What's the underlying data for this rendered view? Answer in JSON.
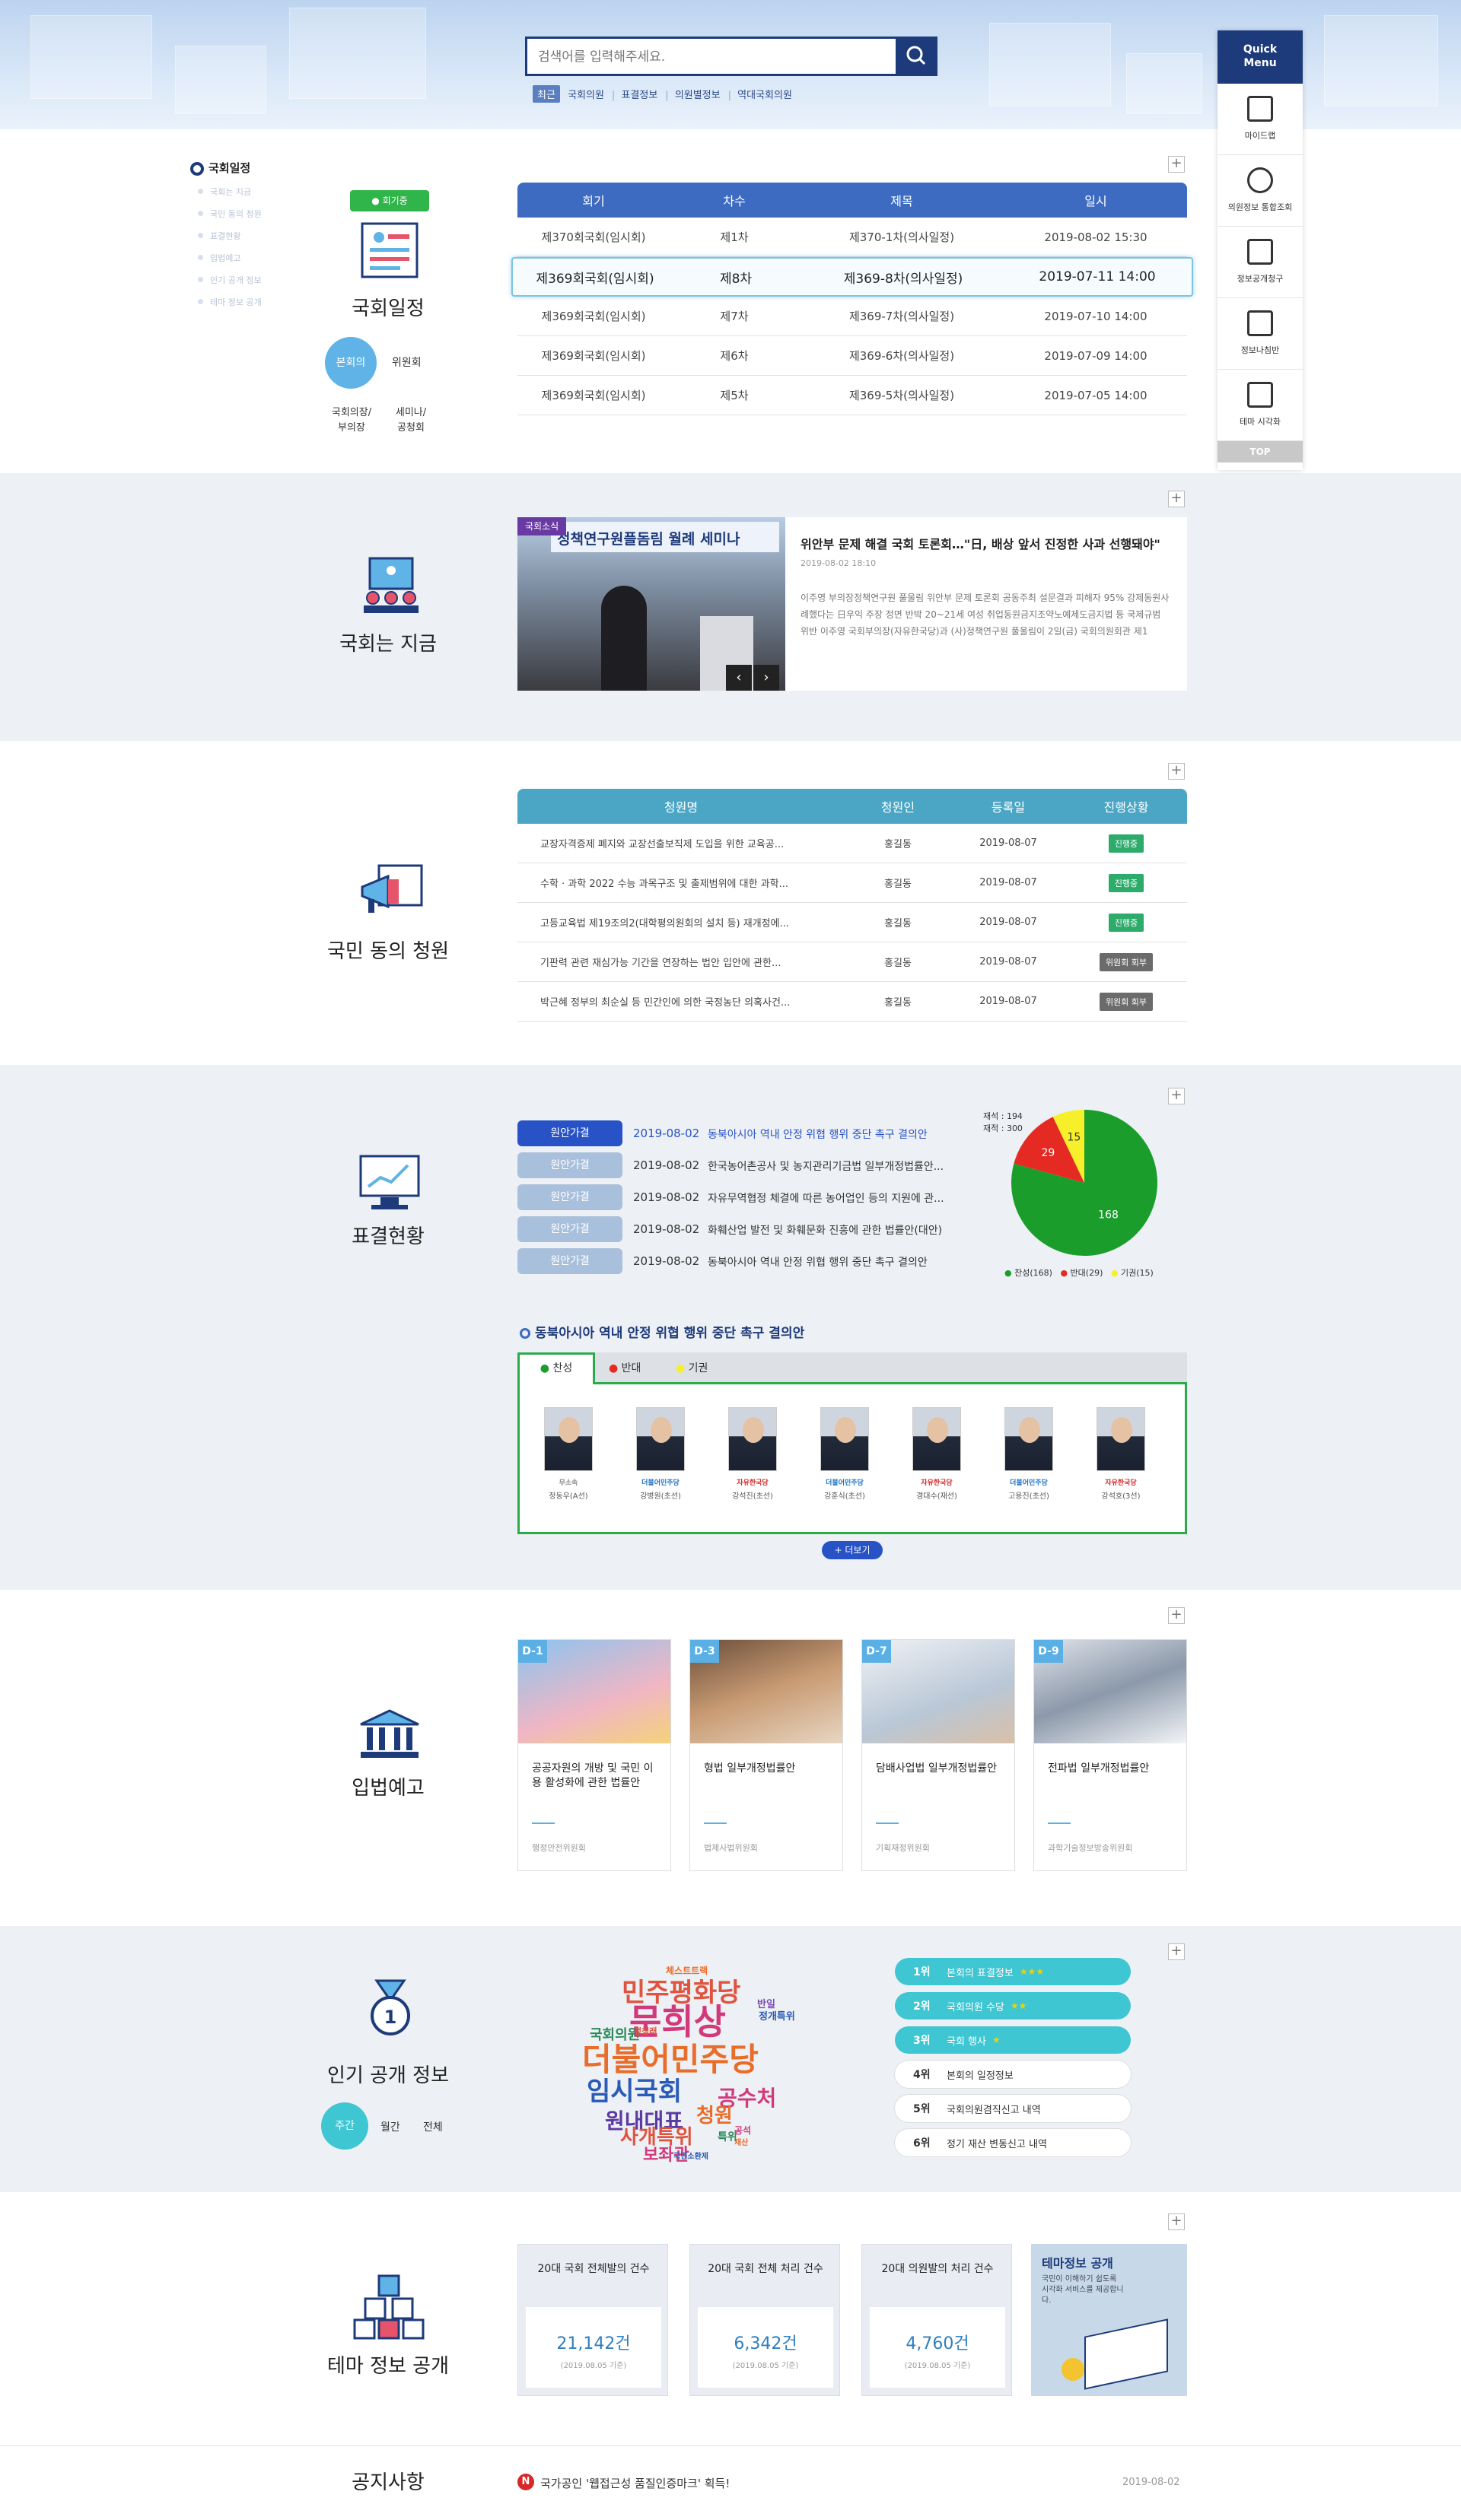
{
  "search": {
    "placeholder": "검색어를 입력해주세요.",
    "recent_label": "최근",
    "tags": [
      "국회의원",
      "표결정보",
      "의원별정보",
      "역대국회의원"
    ]
  },
  "quick_menu": {
    "title_line1": "Quick",
    "title_line2": "Menu",
    "items": [
      "마이드랩",
      "의원정보 통합조회",
      "정보공개청구",
      "정보나침반",
      "테마 시각화"
    ],
    "top": "TOP"
  },
  "sidenav": {
    "current": "국회일정",
    "items": [
      "국회는 지금",
      "국민 동의 청원",
      "표결현황",
      "입법예고",
      "인기 공개 정보",
      "테마 정보 공개"
    ]
  },
  "schedule": {
    "badge": "회기중",
    "title": "국회일정",
    "tab_active": "본회의",
    "tab_other": "위원회",
    "tab3": "국회의장/부의장",
    "tab4": "세미나/공청회",
    "headers": [
      "회기",
      "차수",
      "제목",
      "일시"
    ],
    "rows": [
      [
        "제370회국회(임시회)",
        "제1차",
        "제370-1차(의사일정)",
        "2019-08-02 15:30"
      ],
      [
        "제369회국회(임시회)",
        "제8차",
        "제369-8차(의사일정)",
        "2019-07-11 14:00"
      ],
      [
        "제369회국회(임시회)",
        "제7차",
        "제369-7차(의사일정)",
        "2019-07-10 14:00"
      ],
      [
        "제369회국회(임시회)",
        "제6차",
        "제369-6차(의사일정)",
        "2019-07-09 14:00"
      ],
      [
        "제369회국회(임시회)",
        "제5차",
        "제369-5차(의사일정)",
        "2019-07-05 14:00"
      ]
    ]
  },
  "news": {
    "section_title": "국회는 지금",
    "tag": "국회소식",
    "banner_text": "정책연구원플돔림 월례 세미나",
    "headline": "위안부 문제 해결 국회 토론회…\"日, 배상 앞서 진정한 사과 선행돼야\"",
    "date": "2019-08-02 18:10",
    "body": "이주영 부의장정책연구원 풀울림 위안부 문제 토론회 공동주최 설문결과 피해자 95% 강제동원사례했다는 日우익 주장 정면 반박 20~21세 여성 취업동원금지조약노예제도금지법 등 국제규범 위반 이주영 국회부의장(자유한국당)과 (사)정책연구원 풀울림이 2일(금) 국회의원회관 제1"
  },
  "petition": {
    "section_title": "국민 동의 청원",
    "headers": [
      "청원명",
      "청원인",
      "등록일",
      "진행상황"
    ],
    "rows": [
      {
        "title": "교장자격증제 폐지와 교장선출보직제 도입을 위한 교육공...",
        "author": "홍길동",
        "date": "2019-08-07",
        "status": "진행중"
      },
      {
        "title": "수학 · 과학 2022 수능 과목구조 및 출제범위에 대한 과학...",
        "author": "홍길동",
        "date": "2019-08-07",
        "status": "진행중"
      },
      {
        "title": "고등교육법 제19조의2(대학평의원회의 설치 등) 재개정에...",
        "author": "홍길동",
        "date": "2019-08-07",
        "status": "진행중"
      },
      {
        "title": "기판력 관련 재심가능 기간을 연장하는 법안 입안에 관한...",
        "author": "홍길동",
        "date": "2019-08-07",
        "status": "위원회 회부"
      },
      {
        "title": "박근혜 정부의 최순실 등 민간인에 의한 국정농단 의혹사건...",
        "author": "홍길동",
        "date": "2019-08-07",
        "status": "위원회 회부"
      }
    ],
    "colors": {
      "ongoing": "#2cab6a",
      "committee": "#6b6b6b"
    }
  },
  "vote": {
    "section_title": "표결현황",
    "rows": [
      {
        "tag": "원안가결",
        "date": "2019-08-02",
        "title": "동북아시아 역내 안정 위협 행위 중단 촉구 결의안"
      },
      {
        "tag": "원안가결",
        "date": "2019-08-02",
        "title": "한국농어촌공사 및 농지관리기금법 일부개정법률안..."
      },
      {
        "tag": "원안가결",
        "date": "2019-08-02",
        "title": "자유무역협정 체결에 따른 농어업인 등의 지원에 관..."
      },
      {
        "tag": "원안가결",
        "date": "2019-08-02",
        "title": "화훼산업 발전 및 화훼문화 진흥에 관한 법률안(대안)"
      },
      {
        "tag": "원안가결",
        "date": "2019-08-02",
        "title": "동북아시아 역내 안정 위협 행위 중단 촉구 결의안"
      }
    ],
    "total_label": "재석 : 194",
    "present_label": "재적 : 300",
    "detail_title": "동북아시아 역내 안정 위협 행위 중단 촉구 결의안",
    "tabs": [
      "찬성",
      "반대",
      "기권"
    ],
    "more": "+ 더보기",
    "members": [
      {
        "party": "무소속",
        "name": "정동우(A선)"
      },
      {
        "party": "더불어민주당",
        "name": "강병원(초선)"
      },
      {
        "party": "자유한국당",
        "name": "강석진(초선)"
      },
      {
        "party": "더불어민주당",
        "name": "강훈식(초선)"
      },
      {
        "party": "자유한국당",
        "name": "경대수(재선)"
      },
      {
        "party": "더불어민주당",
        "name": "고용진(초선)"
      },
      {
        "party": "자유한국당",
        "name": "강석호(3선)"
      }
    ]
  },
  "chart_data": {
    "type": "pie",
    "categories": [
      "찬성",
      "반대",
      "기권"
    ],
    "values": [
      168,
      29,
      15
    ],
    "legend": [
      "찬성(168)",
      "반대(29)",
      "기권(15)"
    ],
    "colors": [
      "#1a9d2b",
      "#e42a23",
      "#f6ef2a"
    ]
  },
  "legislation": {
    "section_title": "입법예고",
    "cards": [
      {
        "d": "D-1",
        "title": "공공자원의 개방 및 국민 이용 활성화에 관한 법률안",
        "committee": "행정안전위원회"
      },
      {
        "d": "D-3",
        "title": "형법 일부개정법률안",
        "committee": "법제사법위원회"
      },
      {
        "d": "D-7",
        "title": "담배사업법 일부개정법률안",
        "committee": "기획재정위원회"
      },
      {
        "d": "D-9",
        "title": "전파법 일부개정법률안",
        "committee": "과학기술정보방송위원회"
      }
    ]
  },
  "popular": {
    "section_title": "인기 공개 정보",
    "tabs": [
      "주간",
      "월간",
      "전체"
    ],
    "words": [
      {
        "t": "민주평화당",
        "c": "#e0543f",
        "s": 34
      },
      {
        "t": "문희상",
        "c": "#d2397a",
        "s": 46
      },
      {
        "t": "더불어민주당",
        "c": "#e96d2a",
        "s": 42
      },
      {
        "t": "임시국회",
        "c": "#2a5bb8",
        "s": 34
      },
      {
        "t": "공수처",
        "c": "#d2397a",
        "s": 28
      },
      {
        "t": "원내대표",
        "c": "#5b3aa4",
        "s": 28
      },
      {
        "t": "청원",
        "c": "#e96d2a",
        "s": 26
      },
      {
        "t": "사개특위",
        "c": "#e0543f",
        "s": 26
      },
      {
        "t": "보좌관",
        "c": "#d2397a",
        "s": 22
      },
      {
        "t": "국회의원",
        "c": "#2a8a5a",
        "s": 18
      },
      {
        "t": "체스트트랙",
        "c": "#e96d2a",
        "s": 12
      },
      {
        "t": "정개특위",
        "c": "#2a5bb8",
        "s": 13
      },
      {
        "t": "반일",
        "c": "#7a4bb0",
        "s": 13
      },
      {
        "t": "정청래",
        "c": "#e0543f",
        "s": 11
      },
      {
        "t": "재산",
        "c": "#e96d2a",
        "s": 10
      },
      {
        "t": "국민소환제",
        "c": "#2a5bb8",
        "s": 10
      },
      {
        "t": "특위",
        "c": "#2a8a5a",
        "s": 14
      },
      {
        "t": "공석",
        "c": "#d2397a",
        "s": 12
      }
    ],
    "ranks": [
      {
        "rank": "1위",
        "label": "본회의 표결정보",
        "stars": "★★★"
      },
      {
        "rank": "2위",
        "label": "국회의원 수당",
        "stars": "★★"
      },
      {
        "rank": "3위",
        "label": "국회 행사",
        "stars": "★"
      },
      {
        "rank": "4위",
        "label": "본회의 일정정보",
        "stars": ""
      },
      {
        "rank": "5위",
        "label": "국회의원겸직신고 내역",
        "stars": ""
      },
      {
        "rank": "6위",
        "label": "정기 재산 변동신고 내역",
        "stars": ""
      }
    ]
  },
  "theme": {
    "section_title": "테마 정보 공개",
    "stats": [
      {
        "label": "20대 국회 전체발의 건수",
        "value": "21,142건",
        "sub": "(2019.08.05 기준)"
      },
      {
        "label": "20대 국회 전체 처리 건수",
        "value": "6,342건",
        "sub": "(2019.08.05 기준)"
      },
      {
        "label": "20대 의원발의 처리 건수",
        "value": "4,760건",
        "sub": "(2019.08.05 기준)"
      }
    ],
    "promo_title": "테마정보 공개",
    "promo_text": "국민이 이해하기 쉽도록 시각화 서비스를 제공합니다."
  },
  "notice": {
    "section_title": "공지사항",
    "text": "국가공인 '웹접근성 품질인증마크' 획득!",
    "date": "2019-08-02"
  }
}
